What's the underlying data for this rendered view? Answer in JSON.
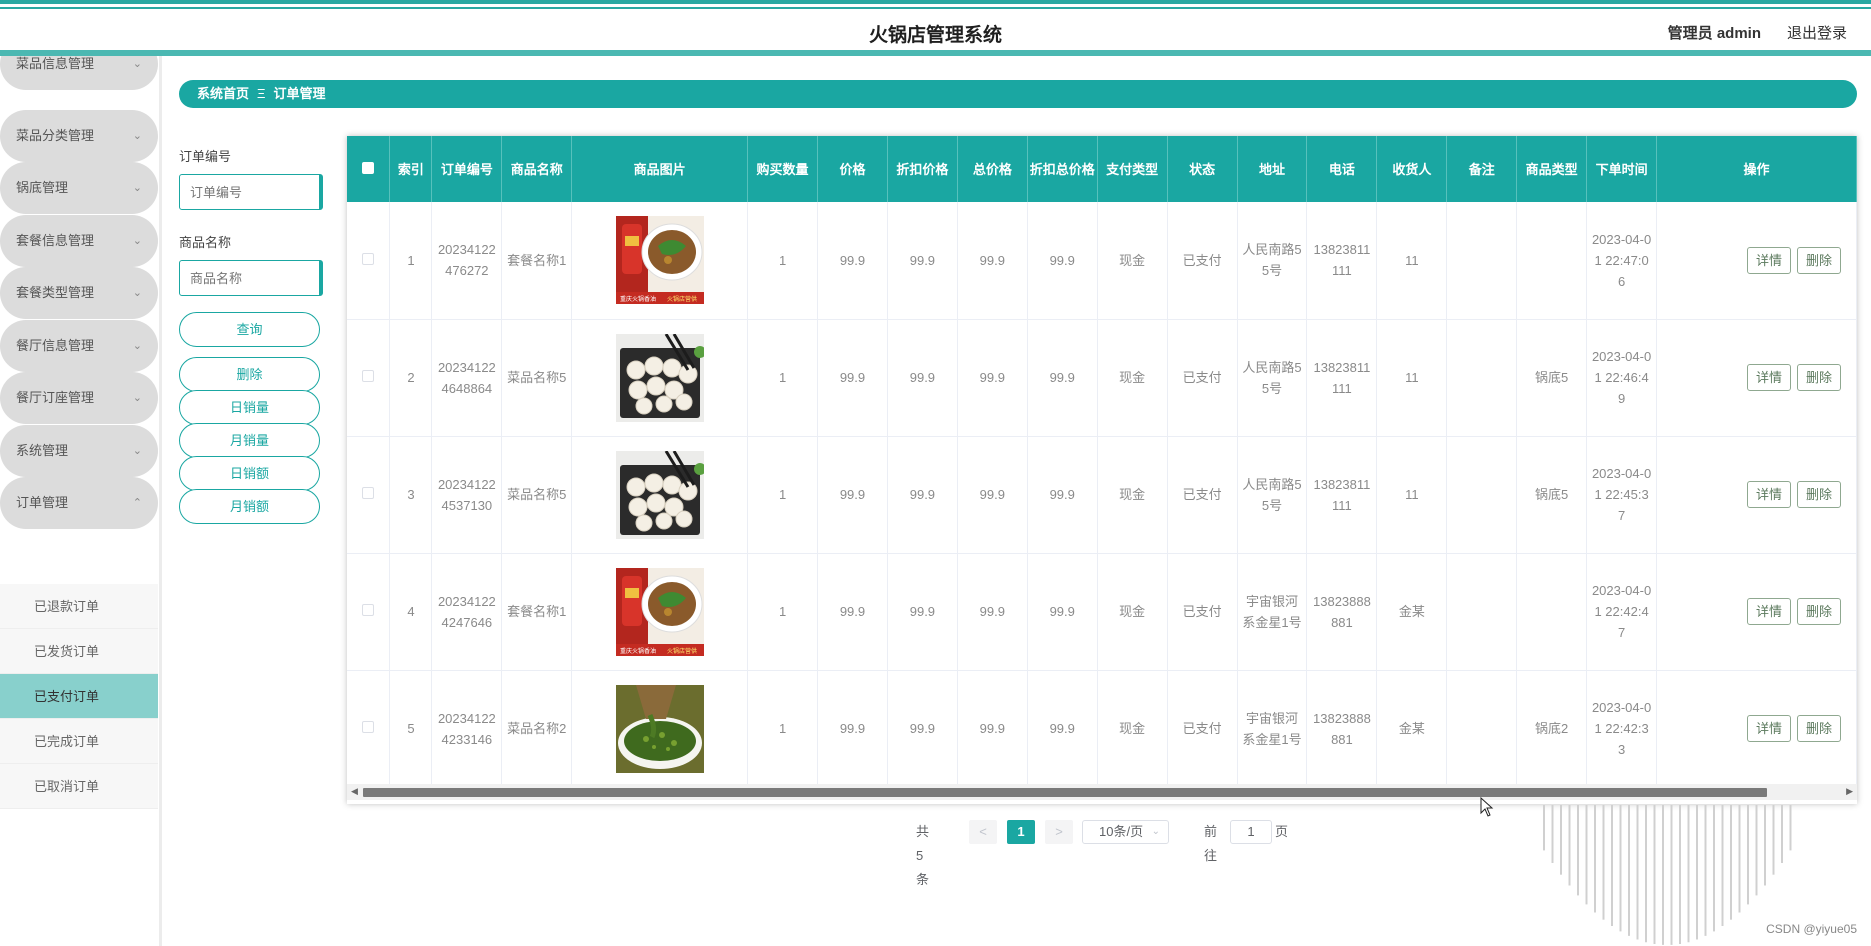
{
  "header": {
    "title": "火锅店管理系统",
    "user": "管理员 admin",
    "logout": "退出登录"
  },
  "sidebar": {
    "items": [
      {
        "label": "菜品信息管理"
      },
      {
        "label": "菜品分类管理"
      },
      {
        "label": "锅底管理"
      },
      {
        "label": "套餐信息管理"
      },
      {
        "label": "套餐类型管理"
      },
      {
        "label": "餐厅信息管理"
      },
      {
        "label": "餐厅订座管理"
      },
      {
        "label": "系统管理"
      },
      {
        "label": "订单管理"
      }
    ],
    "submenu": [
      {
        "label": "已退款订单"
      },
      {
        "label": "已发货订单"
      },
      {
        "label": "已支付订单",
        "active": true
      },
      {
        "label": "已完成订单"
      },
      {
        "label": "已取消订单"
      }
    ]
  },
  "breadcrumb": {
    "home": "系统首页",
    "separator": "Ξ",
    "current": "订单管理"
  },
  "filters": {
    "order_no_label": "订单编号",
    "order_no_placeholder": "订单编号",
    "product_label": "商品名称",
    "product_placeholder": "商品名称",
    "query": "查询",
    "delete": "删除",
    "daily_sales": "日销量",
    "monthly_sales": "月销量",
    "daily_revenue": "日销额",
    "monthly_revenue": "月销额"
  },
  "table": {
    "columns": [
      "索引",
      "订单编号",
      "商品名称",
      "商品图片",
      "购买数量",
      "价格",
      "折扣价格",
      "总价格",
      "折扣总价格",
      "支付类型",
      "状态",
      "地址",
      "电话",
      "收货人",
      "备注",
      "商品类型",
      "下单时间",
      "操作"
    ],
    "rows": [
      {
        "index": "1",
        "order_no": "20234122476272",
        "name": "套餐名称1",
        "image": "hotpot-bowl",
        "qty": "1",
        "price": "99.9",
        "disc_price": "99.9",
        "total": "99.9",
        "disc_total": "99.9",
        "pay": "现金",
        "status": "已支付",
        "address": "人民南路55号",
        "phone": "13823811111",
        "receiver": "11",
        "remark": "",
        "type": "",
        "time": "2023-04-01 22:47:06"
      },
      {
        "index": "2",
        "order_no": "202341224648864",
        "name": "菜品名称5",
        "image": "dumplings",
        "qty": "1",
        "price": "99.9",
        "disc_price": "99.9",
        "total": "99.9",
        "disc_total": "99.9",
        "pay": "现金",
        "status": "已支付",
        "address": "人民南路55号",
        "phone": "13823811111",
        "receiver": "11",
        "remark": "",
        "type": "锅底5",
        "time": "2023-04-01 22:46:49"
      },
      {
        "index": "3",
        "order_no": "202341224537130",
        "name": "菜品名称5",
        "image": "dumplings",
        "qty": "1",
        "price": "99.9",
        "disc_price": "99.9",
        "total": "99.9",
        "disc_total": "99.9",
        "pay": "现金",
        "status": "已支付",
        "address": "人民南路55号",
        "phone": "13823811111",
        "receiver": "11",
        "remark": "",
        "type": "锅底5",
        "time": "2023-04-01 22:45:37"
      },
      {
        "index": "4",
        "order_no": "202341224247646",
        "name": "套餐名称1",
        "image": "hotpot-bowl",
        "qty": "1",
        "price": "99.9",
        "disc_price": "99.9",
        "total": "99.9",
        "disc_total": "99.9",
        "pay": "现金",
        "status": "已支付",
        "address": "宇宙银河系金星1号",
        "phone": "13823888881",
        "receiver": "金某",
        "remark": "",
        "type": "",
        "time": "2023-04-01 22:42:47"
      },
      {
        "index": "5",
        "order_no": "202341224233146",
        "name": "菜品名称2",
        "image": "green-sauce",
        "qty": "1",
        "price": "99.9",
        "disc_price": "99.9",
        "total": "99.9",
        "disc_total": "99.9",
        "pay": "现金",
        "status": "已支付",
        "address": "宇宙银河系金星1号",
        "phone": "13823888881",
        "receiver": "金某",
        "remark": "",
        "type": "锅底2",
        "time": "2023-04-01 22:42:33"
      }
    ],
    "detail_btn": "详情",
    "delete_btn": "删除",
    "banner_left": "重庆火锅香油",
    "banner_right": "火锅店营供"
  },
  "pager": {
    "total": "共 5 条",
    "prev": "<",
    "current": "1",
    "next": ">",
    "page_size": "10条/页",
    "goto": "前往",
    "goto_value": "1",
    "page_unit": "页"
  },
  "watermark": "CSDN @yiyue05",
  "colors": {
    "accent": "#1aa7a2",
    "active_sub": "#88d0cc"
  }
}
